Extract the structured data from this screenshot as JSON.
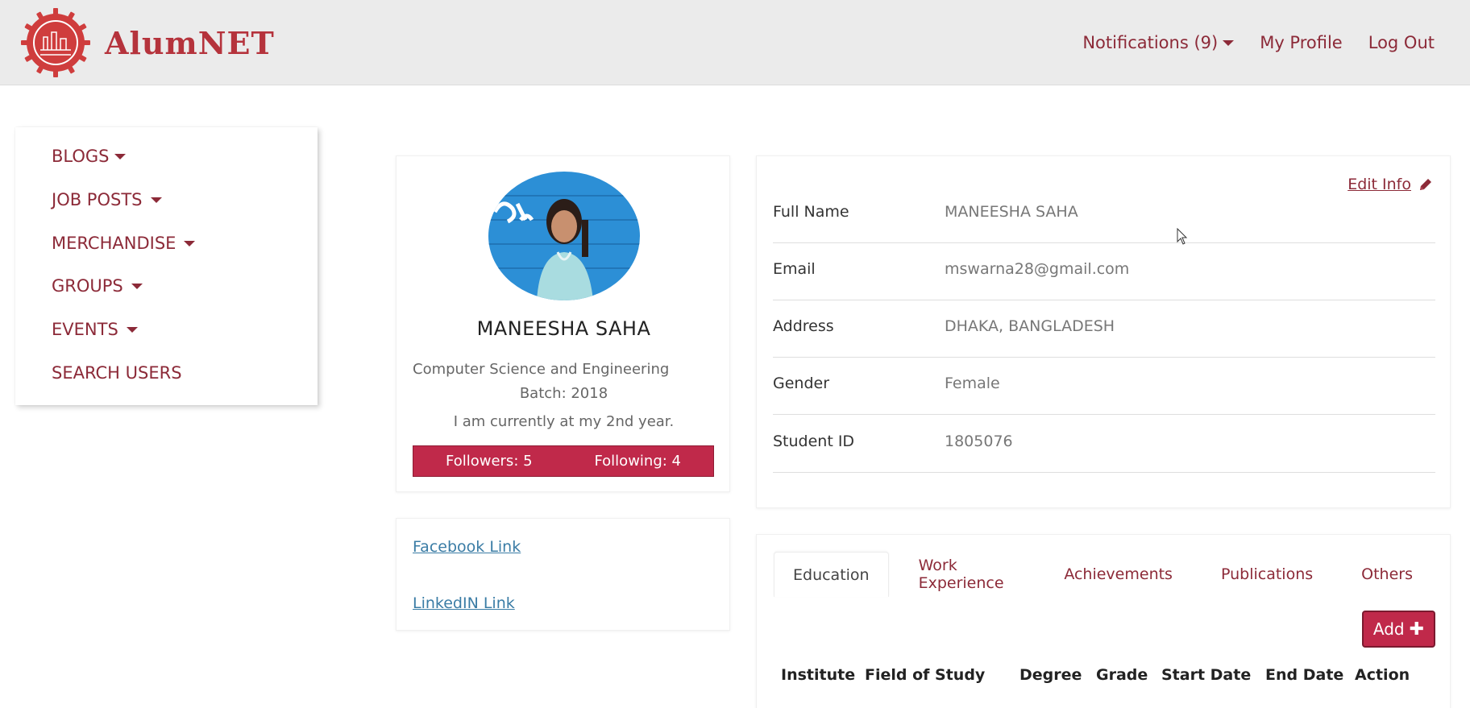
{
  "brand": {
    "name": "AlumNET"
  },
  "navbar": {
    "notifications": "Notifications (9)",
    "my_profile": "My Profile",
    "logout": "Log Out"
  },
  "sidebar": {
    "items": [
      {
        "label": "BLOGS"
      },
      {
        "label": "JOB POSTS"
      },
      {
        "label": "MERCHANDISE"
      },
      {
        "label": "GROUPS"
      },
      {
        "label": "EVENTS"
      },
      {
        "label": "SEARCH USERS"
      }
    ]
  },
  "profile": {
    "name": "MANEESHA SAHA",
    "department": "Computer Science and Engineering",
    "batch": "Batch: 2018",
    "bio": "I am currently at my 2nd year.",
    "followers": "Followers: 5",
    "following": "Following: 4"
  },
  "links": {
    "facebook": "Facebook Link",
    "linkedin": "LinkedIN Link"
  },
  "info": {
    "edit_label": "Edit Info",
    "rows": [
      {
        "label": "Full Name",
        "value": "MANEESHA SAHA"
      },
      {
        "label": "Email",
        "value": "mswarna28@gmail.com"
      },
      {
        "label": "Address",
        "value": "DHAKA, BANGLADESH"
      },
      {
        "label": "Gender",
        "value": "Female"
      },
      {
        "label": "Student ID",
        "value": "1805076"
      }
    ]
  },
  "tabs": {
    "items": [
      {
        "label": "Education"
      },
      {
        "label": "Work Experience"
      },
      {
        "label": "Achievements"
      },
      {
        "label": "Publications"
      },
      {
        "label": "Others"
      }
    ],
    "add_label": "Add",
    "columns": [
      "Institute",
      "Field of Study",
      "Degree",
      "Grade",
      "Start Date",
      "End Date",
      "Action"
    ]
  },
  "colors": {
    "accent": "#c0294a",
    "link_text": "#8c2a38",
    "navbar_bg": "#ebebeb"
  }
}
